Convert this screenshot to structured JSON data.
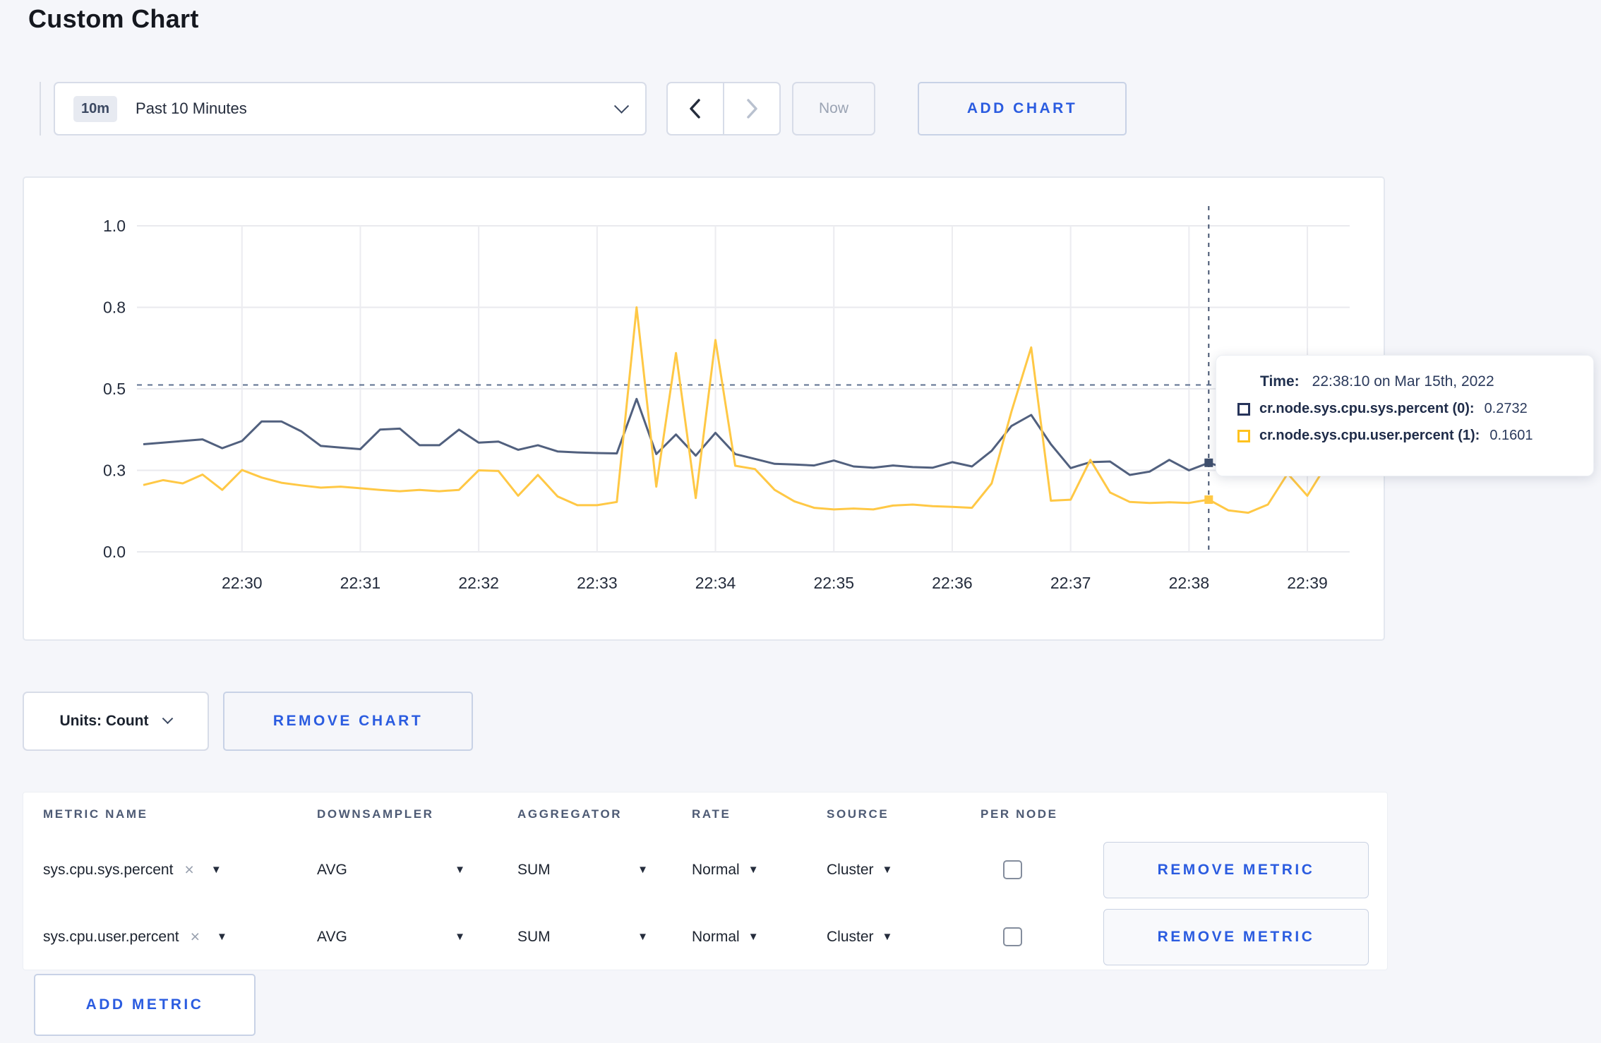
{
  "page": {
    "title": "Custom Chart",
    "background": "#f5f6fa",
    "accent_blue": "#2b5ce0"
  },
  "toolbar": {
    "range_badge": "10m",
    "range_label": "Past 10 Minutes",
    "prev_icon": "chevron-left",
    "next_icon": "chevron-right",
    "now_label": "Now",
    "add_chart_label": "ADD CHART"
  },
  "chart_data": {
    "type": "line",
    "title": "",
    "xlabel": "",
    "ylabel": "",
    "ylim": [
      0,
      1
    ],
    "grid": true,
    "x_start": "22:29:10",
    "x_end": "22:39:10",
    "x_interval_seconds": 10,
    "x_tick_labels": [
      "22:30",
      "22:31",
      "22:32",
      "22:33",
      "22:34",
      "22:35",
      "22:36",
      "22:37",
      "22:38",
      "22:39"
    ],
    "y_tick_values": [
      0,
      0.25,
      0.5,
      0.75,
      1
    ],
    "y_tick_labels": [
      "0.0",
      "0.3",
      "0.5",
      "0.8",
      "1.0"
    ],
    "guide_line_value": 0.512,
    "crosshair": {
      "time": "22:38:10",
      "index": 54
    },
    "series": [
      {
        "name": "cr.node.sys.cpu.sys.percent",
        "color": "#51607e",
        "marker_color": "#3f4f6d",
        "values": [
          0.33,
          0.335,
          0.34,
          0.345,
          0.318,
          0.34,
          0.4,
          0.4,
          0.37,
          0.325,
          0.32,
          0.315,
          0.375,
          0.378,
          0.327,
          0.327,
          0.375,
          0.335,
          0.338,
          0.313,
          0.327,
          0.308,
          0.305,
          0.303,
          0.302,
          0.469,
          0.3,
          0.36,
          0.295,
          0.365,
          0.3,
          0.285,
          0.27,
          0.268,
          0.265,
          0.28,
          0.262,
          0.258,
          0.265,
          0.26,
          0.258,
          0.275,
          0.262,
          0.31,
          0.386,
          0.42,
          0.33,
          0.257,
          0.275,
          0.277,
          0.236,
          0.246,
          0.282,
          0.25,
          0.2732,
          0.254,
          0.26,
          0.27,
          0.285,
          0.28,
          0.3
        ]
      },
      {
        "name": "cr.node.sys.cpu.user.percent",
        "color": "#ffc845",
        "marker_color": "#ffc845",
        "values": [
          0.205,
          0.22,
          0.21,
          0.237,
          0.19,
          0.251,
          0.228,
          0.212,
          0.204,
          0.197,
          0.2,
          0.195,
          0.19,
          0.186,
          0.19,
          0.186,
          0.19,
          0.25,
          0.248,
          0.172,
          0.236,
          0.17,
          0.143,
          0.143,
          0.153,
          0.75,
          0.2,
          0.61,
          0.165,
          0.65,
          0.264,
          0.254,
          0.19,
          0.155,
          0.135,
          0.13,
          0.133,
          0.13,
          0.142,
          0.145,
          0.14,
          0.138,
          0.135,
          0.21,
          0.43,
          0.627,
          0.157,
          0.16,
          0.282,
          0.182,
          0.153,
          0.15,
          0.152,
          0.15,
          0.1601,
          0.127,
          0.12,
          0.145,
          0.24,
          0.172,
          0.27
        ]
      }
    ]
  },
  "tooltip": {
    "time_label": "Time:",
    "time_value": "22:38:10 on Mar 15th, 2022",
    "series": [
      {
        "label": "cr.node.sys.cpu.sys.percent (0):",
        "value": "0.2732",
        "color": "#27345a"
      },
      {
        "label": "cr.node.sys.cpu.user.percent (1):",
        "value": "0.1601",
        "color": "#ffc21e"
      }
    ]
  },
  "units": {
    "label": "Units: Count",
    "remove_chart_label": "REMOVE CHART"
  },
  "metrics_table": {
    "columns": [
      "METRIC NAME",
      "DOWNSAMPLER",
      "AGGREGATOR",
      "RATE",
      "SOURCE",
      "PER NODE"
    ],
    "rows": [
      {
        "metric": "sys.cpu.sys.percent",
        "downsampler": "AVG",
        "aggregator": "SUM",
        "rate": "Normal",
        "source": "Cluster",
        "per_node_checked": false,
        "remove_label": "REMOVE METRIC"
      },
      {
        "metric": "sys.cpu.user.percent",
        "downsampler": "AVG",
        "aggregator": "SUM",
        "rate": "Normal",
        "source": "Cluster",
        "per_node_checked": false,
        "remove_label": "REMOVE METRIC"
      }
    ],
    "add_metric_label": "ADD METRIC"
  }
}
